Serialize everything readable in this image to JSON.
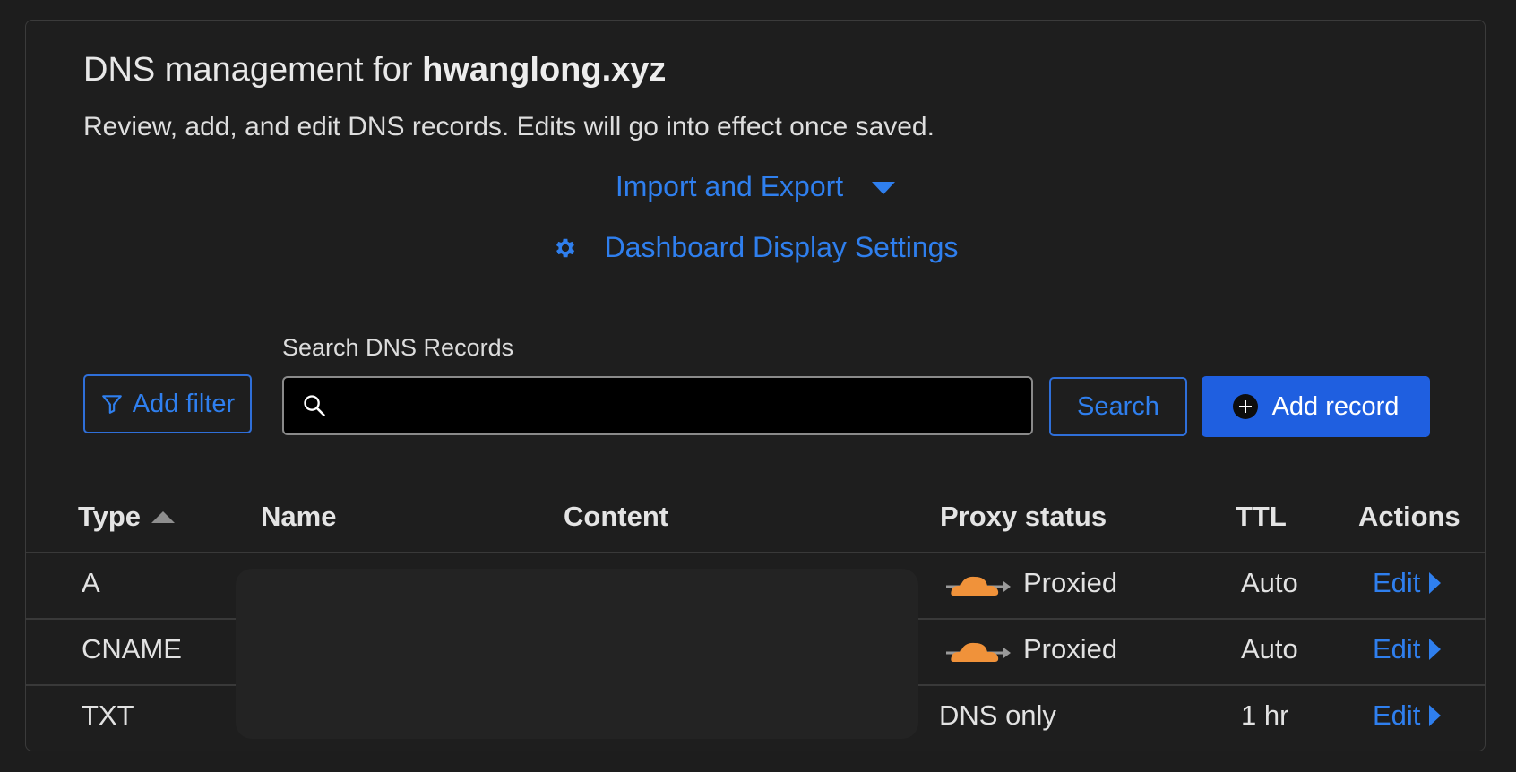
{
  "header": {
    "title_prefix": "DNS management for ",
    "domain": "hwanglong.xyz",
    "description": "Review, add, and edit DNS records. Edits will go into effect once saved."
  },
  "links": {
    "import_export": "Import and Export",
    "dashboard_settings": "Dashboard Display Settings"
  },
  "toolbar": {
    "add_filter": "Add filter",
    "search_label": "Search DNS Records",
    "search_value": "",
    "search_button": "Search",
    "add_record": "Add record"
  },
  "table": {
    "columns": [
      "Type",
      "Name",
      "Content",
      "Proxy status",
      "TTL",
      "Actions"
    ],
    "rows": [
      {
        "type": "A",
        "name": "",
        "content": "",
        "proxy": "Proxied",
        "proxy_icon": "cloud-proxied-icon",
        "ttl": "Auto",
        "action": "Edit"
      },
      {
        "type": "CNAME",
        "name": "",
        "content": "",
        "proxy": "Proxied",
        "proxy_icon": "cloud-proxied-icon",
        "ttl": "Auto",
        "action": "Edit"
      },
      {
        "type": "TXT",
        "name": "",
        "content": "",
        "proxy": "DNS only",
        "proxy_icon": "",
        "ttl": "1 hr",
        "action": "Edit"
      }
    ]
  },
  "colors": {
    "accent": "#2f7fee",
    "primary_button": "#1f5fe0",
    "cloud": "#f0923a",
    "background": "#1e1e1e"
  }
}
